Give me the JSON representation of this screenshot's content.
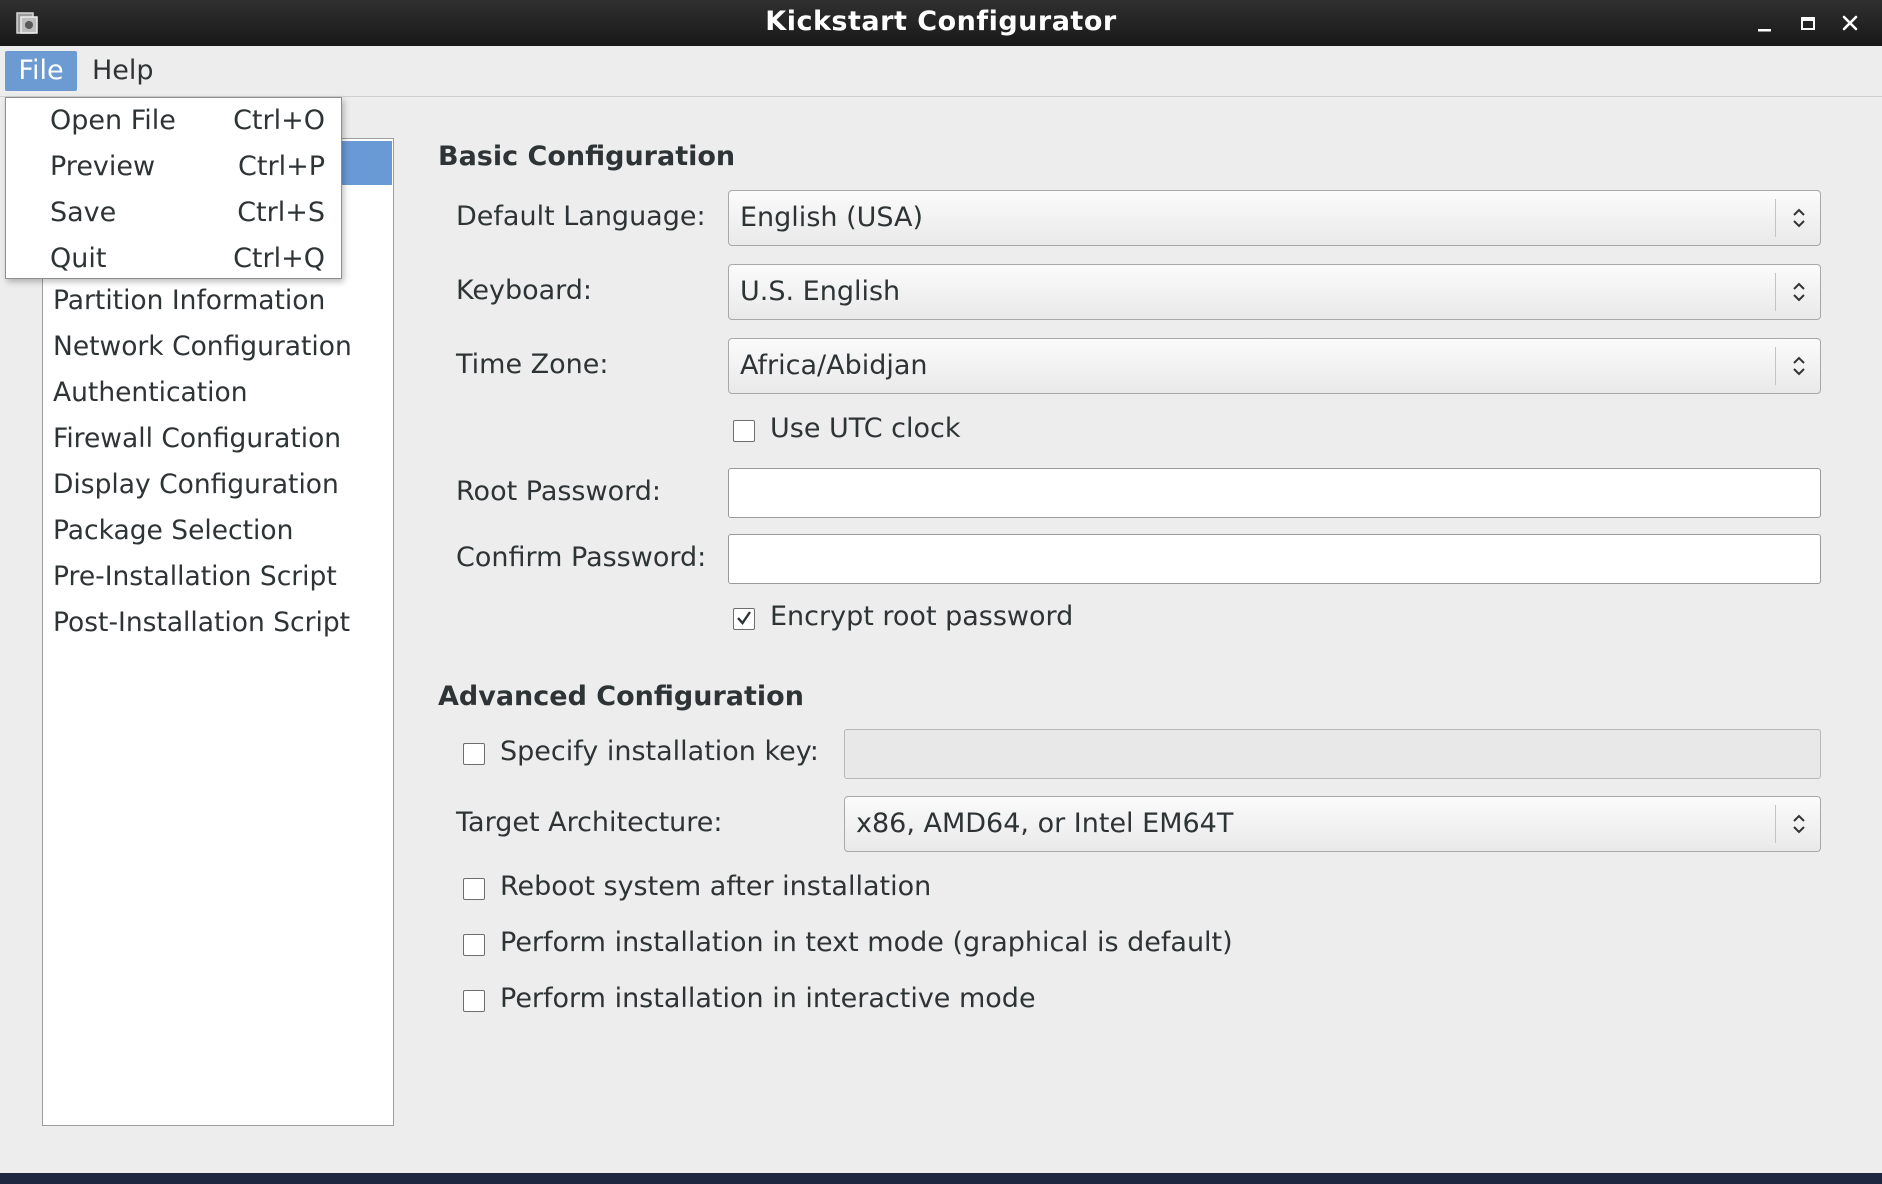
{
  "window": {
    "title": "Kickstart Configurator",
    "app_icon": "kickstart-app-icon",
    "controls": [
      "minimize-icon",
      "maximize-icon",
      "close-icon"
    ]
  },
  "menubar": {
    "file": "File",
    "help": "Help"
  },
  "file_menu": {
    "items": [
      {
        "label": "Open File",
        "accel": "Ctrl+O"
      },
      {
        "label": "Preview",
        "accel": "Ctrl+P"
      },
      {
        "label": "Save",
        "accel": "Ctrl+S"
      },
      {
        "label": "Quit",
        "accel": "Ctrl+Q"
      }
    ]
  },
  "sidebar": {
    "items": [
      "Partition Information",
      "Network Configuration",
      "Authentication",
      "Firewall Configuration",
      "Display Configuration",
      "Package Selection",
      "Pre-Installation Script",
      "Post-Installation Script"
    ]
  },
  "basic": {
    "title": "Basic Configuration",
    "language_label": "Default Language:",
    "language_value": "English (USA)",
    "keyboard_label": "Keyboard:",
    "keyboard_value": "U.S. English",
    "timezone_label": "Time Zone:",
    "timezone_value": "Africa/Abidjan",
    "utc_label": "Use UTC clock",
    "utc_checked": false,
    "root_password_label": "Root Password:",
    "root_password_value": "",
    "confirm_password_label": "Confirm Password:",
    "confirm_password_value": "",
    "encrypt_label": "Encrypt root password",
    "encrypt_checked": true
  },
  "advanced": {
    "title": "Advanced Configuration",
    "install_key_label": "Specify installation key:",
    "install_key_checked": false,
    "install_key_value": "",
    "arch_label": "Target Architecture:",
    "arch_value": "x86, AMD64, or Intel EM64T",
    "reboot_label": "Reboot system after installation",
    "reboot_checked": false,
    "text_mode_label": "Perform installation in text mode (graphical is default)",
    "text_mode_checked": false,
    "interactive_label": "Perform installation in interactive mode",
    "interactive_checked": false
  },
  "colors": {
    "selection": "#6a9ad6",
    "titlebar": "#202020",
    "background": "#ededed"
  }
}
